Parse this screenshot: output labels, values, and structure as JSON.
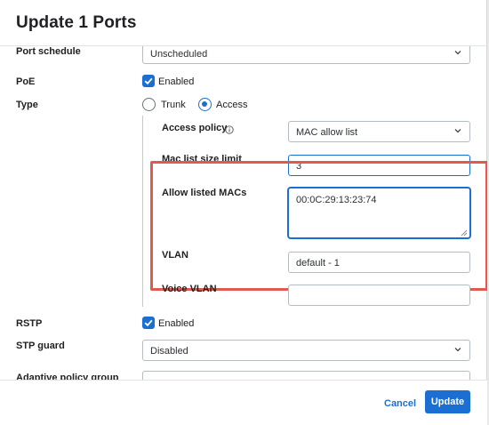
{
  "modal": {
    "title": "Update 1 Ports"
  },
  "form": {
    "port_schedule": {
      "label": "Port schedule",
      "value": "Unscheduled"
    },
    "poe": {
      "label": "PoE",
      "checkbox_label": "Enabled",
      "checked": true
    },
    "type": {
      "label": "Type",
      "options": [
        "Trunk",
        "Access"
      ],
      "selected": "Access"
    },
    "access_policy": {
      "label": "Access policy",
      "value": "MAC allow list",
      "icon": "info-icon"
    },
    "mac_list_size_limit": {
      "label": "Mac list size limit",
      "value": "3"
    },
    "allow_listed_macs": {
      "label": "Allow listed MACs",
      "value": "00:0C:29:13:23:74"
    },
    "vlan": {
      "label": "VLAN",
      "value": "default - 1"
    },
    "voice_vlan": {
      "label": "Voice VLAN",
      "value": ""
    },
    "rstp": {
      "label": "RSTP",
      "checkbox_label": "Enabled",
      "checked": true
    },
    "stp_guard": {
      "label": "STP guard",
      "value": "Disabled"
    },
    "adaptive_policy_group": {
      "label": "Adaptive policy group",
      "value": ""
    }
  },
  "footer": {
    "cancel_label": "Cancel",
    "update_label": "Update"
  },
  "colors": {
    "accent": "#1b6fd2",
    "highlight_border": "#e05a4e"
  }
}
